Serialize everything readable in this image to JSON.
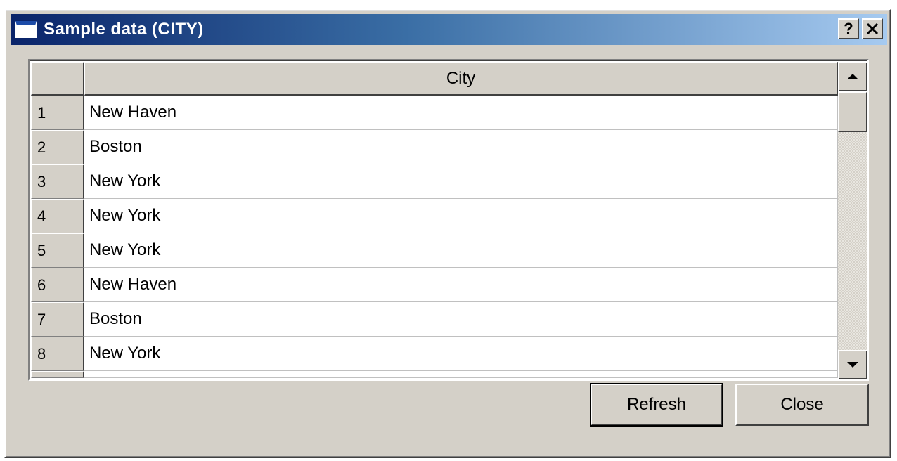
{
  "window": {
    "title": "Sample data (CITY)",
    "help_label": "?",
    "close_label": "✕"
  },
  "grid": {
    "column_header": "City",
    "rows": [
      {
        "num": "1",
        "city": "New Haven"
      },
      {
        "num": "2",
        "city": "Boston"
      },
      {
        "num": "3",
        "city": "New York"
      },
      {
        "num": "4",
        "city": "New York"
      },
      {
        "num": "5",
        "city": "New York"
      },
      {
        "num": "6",
        "city": "New Haven"
      },
      {
        "num": "7",
        "city": "Boston"
      },
      {
        "num": "8",
        "city": "New York"
      }
    ]
  },
  "buttons": {
    "refresh_label": "Refresh",
    "close_label": "Close"
  },
  "colors": {
    "title_gradient_start": "#0a246a",
    "title_gradient_end": "#a6caf0",
    "dialog_face": "#d4d0c8"
  },
  "icons": {
    "window_icon": "window-icon",
    "scroll_up": "triangle-up-icon",
    "scroll_down": "triangle-down-icon"
  }
}
